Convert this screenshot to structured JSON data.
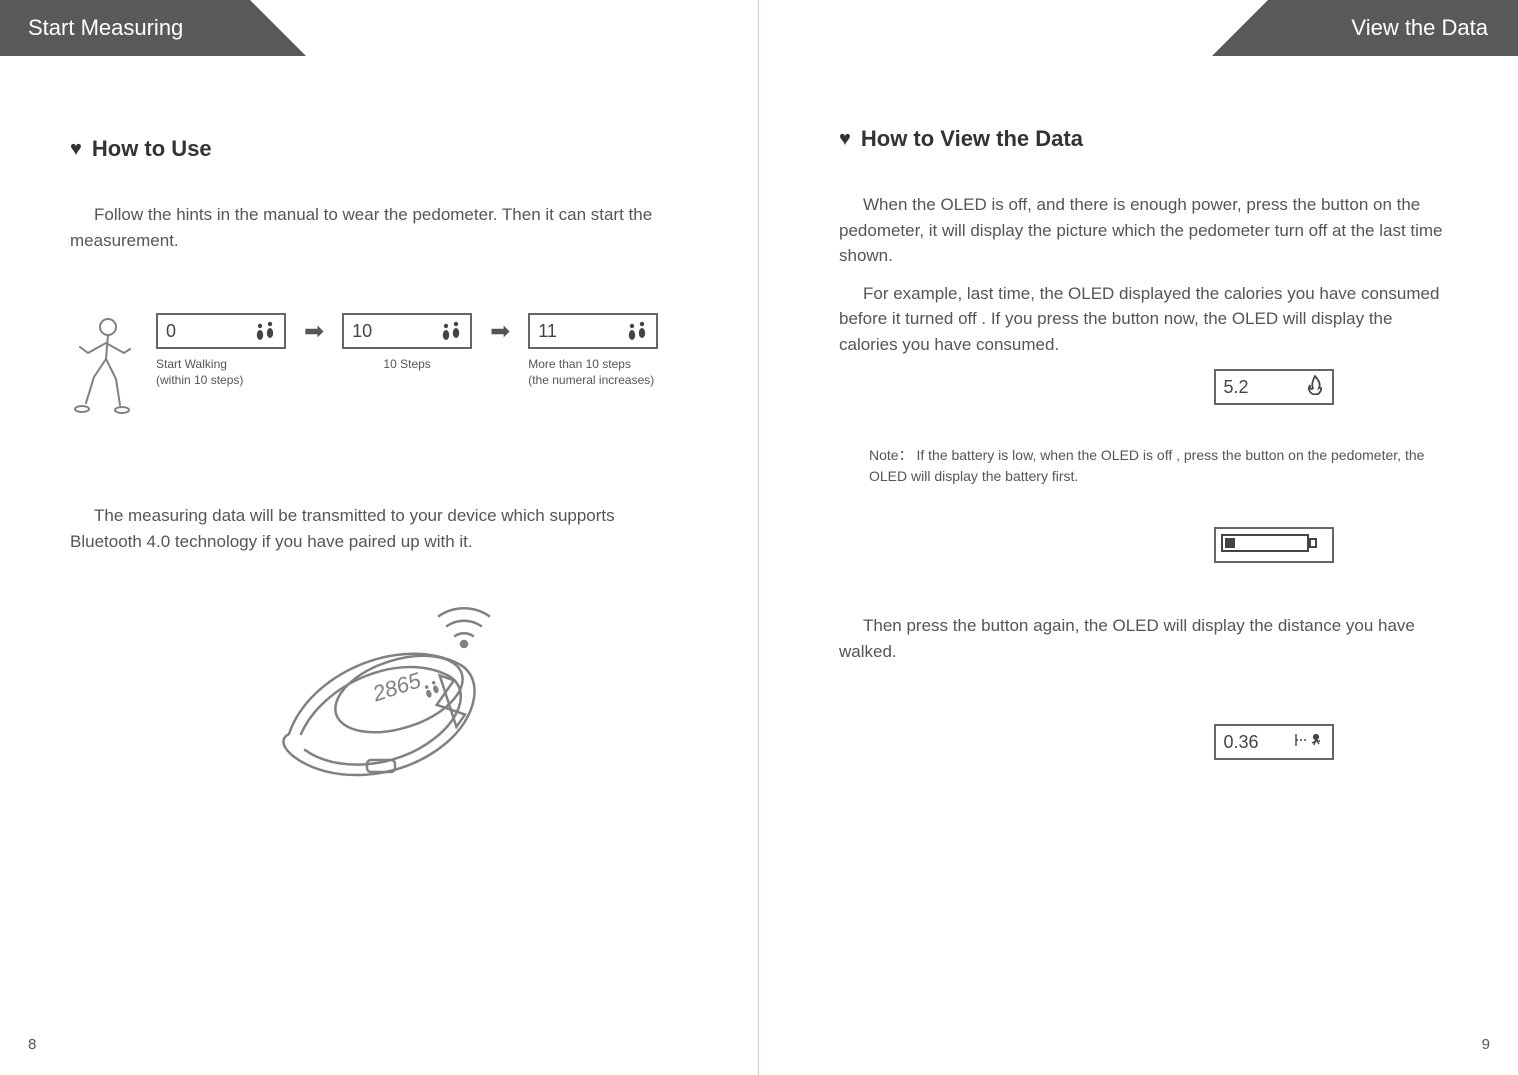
{
  "left": {
    "tab": "Start Measuring",
    "section": "How to Use",
    "intro": "Follow the hints in the manual to wear the pedometer. Then it can start the measurement.",
    "seq": {
      "s1": {
        "value": "0",
        "caption1": "Start Walking",
        "caption2": "(within 10 steps)"
      },
      "s2": {
        "value": "10",
        "caption1": "10 Steps"
      },
      "s3": {
        "value": "11",
        "caption1": "More than 10 steps",
        "caption2": "(the numeral increases)"
      }
    },
    "bt_text": "The measuring data will be transmitted to your device which supports Bluetooth 4.0 technology if you have paired up with it.",
    "wrist_value": "2865",
    "pagenum": "8"
  },
  "right": {
    "tab": "View the Data",
    "section": "How to View the Data",
    "p1": "When the OLED is off, and there is enough power, press the button on the pedometer, it will display the picture which the pedometer turn off at the last time shown.",
    "p2": "For example, last time, the OLED displayed the calories you have consumed before it turned off . If you press the button now, the OLED will display the calories you have consumed.",
    "cal_value": "5.2",
    "note_label": "Note：",
    "note": "If  the battery is low, when the OLED is off , press the button on the pedometer, the OLED will display the battery first.",
    "p3": "Then press the button again, the OLED will display the distance you have walked.",
    "dist_value": "0.36",
    "pagenum": "9"
  }
}
